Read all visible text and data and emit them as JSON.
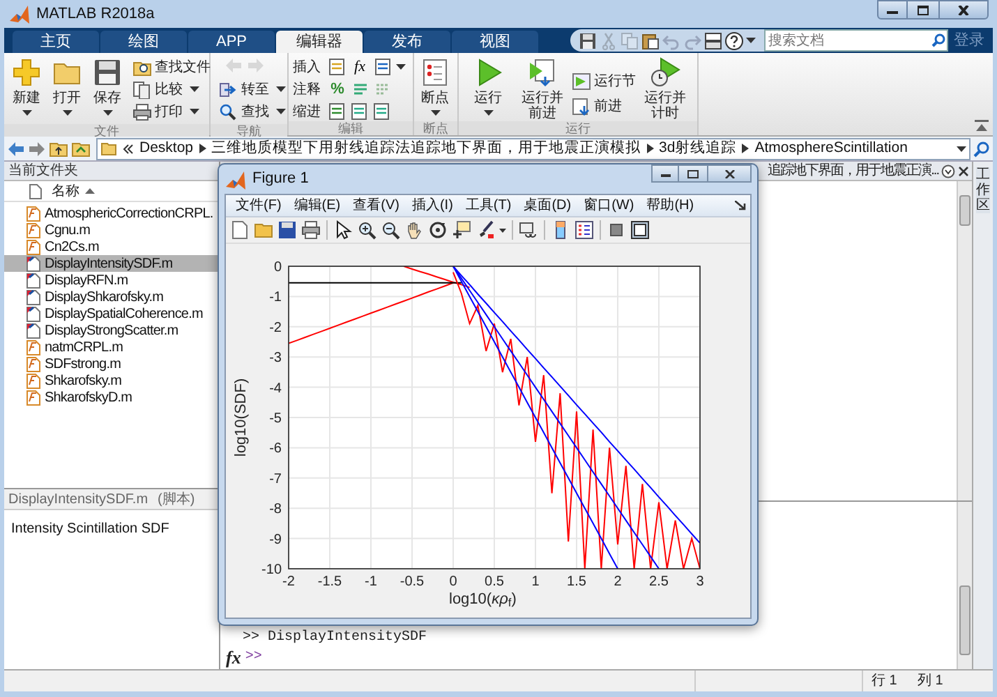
{
  "window": {
    "title": "MATLAB R2018a"
  },
  "tabs": [
    {
      "label": "主页",
      "selected": false
    },
    {
      "label": "绘图",
      "selected": false
    },
    {
      "label": "APP",
      "selected": false
    },
    {
      "label": "编辑器",
      "selected": true
    },
    {
      "label": "发布",
      "selected": false
    },
    {
      "label": "视图",
      "selected": false
    }
  ],
  "quick_access": [
    {
      "disabled": false
    },
    {
      "disabled": true
    },
    {
      "disabled": true
    },
    {
      "disabled": false
    },
    {
      "disabled": true
    },
    {
      "disabled": true
    },
    {
      "disabled": false
    },
    {
      "disabled": false
    }
  ],
  "search": {
    "placeholder": "搜索文档"
  },
  "sign_in": "登录",
  "ribbon": {
    "file": {
      "title": "文件",
      "large": [
        {
          "label": "新建",
          "dropdown": true
        },
        {
          "label": "打开",
          "dropdown": true
        },
        {
          "label": "保存",
          "dropdown": true
        }
      ],
      "small": [
        {
          "label": "查找文件",
          "dropdown": false
        },
        {
          "label": "比较",
          "dropdown": true
        },
        {
          "label": "打印",
          "dropdown": true
        }
      ]
    },
    "navigate": {
      "title": "导航",
      "history": [
        {
          "disabled": true
        },
        {
          "disabled": true
        }
      ],
      "small": [
        {
          "label": "转至",
          "dropdown": true
        },
        {
          "label": "查找",
          "dropdown": true
        }
      ]
    },
    "edit": {
      "title": "编辑",
      "rows": [
        {
          "label": "插入",
          "symbol": "fx"
        },
        {
          "label": "注释",
          "symbol": "%"
        },
        {
          "label": "缩进"
        }
      ]
    },
    "breakpoints": {
      "title": "断点",
      "large": [
        {
          "label": "断点",
          "dropdown": true
        }
      ]
    },
    "run": {
      "title": "运行",
      "items": [
        {
          "kind": "large",
          "label": "运行",
          "dropdown": true
        },
        {
          "kind": "large",
          "label": "运行并前进",
          "dropdown": false
        },
        {
          "kind": "stack",
          "items": [
            {
              "label": "运行节"
            },
            {
              "label": "前进"
            }
          ]
        },
        {
          "kind": "large",
          "label": "运行并计时",
          "dropdown": false
        }
      ]
    }
  },
  "address": {
    "path": [
      "Desktop",
      "三维地质模型下用射线追踪法追踪地下界面，用于地震正演模拟",
      "3d射线追踪",
      "AtmosphereScintillation"
    ]
  },
  "current_folder": {
    "title": "当前文件夹",
    "column": "名称",
    "files": [
      {
        "name": "AtmosphericCorrectionCRPL.",
        "kind": "function",
        "selected": false
      },
      {
        "name": "Cgnu.m",
        "kind": "function",
        "selected": false
      },
      {
        "name": "Cn2Cs.m",
        "kind": "function",
        "selected": false
      },
      {
        "name": "DisplayIntensitySDF.m",
        "kind": "script",
        "selected": true
      },
      {
        "name": "DisplayRFN.m",
        "kind": "script",
        "selected": false
      },
      {
        "name": "DisplayShkarofsky.m",
        "kind": "script",
        "selected": false
      },
      {
        "name": "DisplaySpatialCoherence.m",
        "kind": "script",
        "selected": false
      },
      {
        "name": "DisplayStrongScatter.m",
        "kind": "script",
        "selected": false
      },
      {
        "name": "natmCRPL.m",
        "kind": "function",
        "selected": false
      },
      {
        "name": "SDFstrong.m",
        "kind": "function",
        "selected": false
      },
      {
        "name": "Shkarofsky.m",
        "kind": "function",
        "selected": false
      },
      {
        "name": "ShkarofskyD.m",
        "kind": "function",
        "selected": false
      }
    ],
    "details": {
      "title": "DisplayIntensitySDF.m",
      "type": "(脚本)",
      "description": "Intensity Scintillation SDF"
    }
  },
  "editor": {
    "tab_title": "追踪地下界面，用于地震正演..."
  },
  "workspace": {
    "title": "工作区"
  },
  "command_window": {
    "lines": [
      ">> DisplayIntensitySDF"
    ],
    "fx_label": "fx",
    "prompt": ">>"
  },
  "status_bar": {
    "row": "行 1",
    "column": "列 1"
  },
  "figure": {
    "title": "Figure 1",
    "menu": [
      "文件(F)",
      "编辑(E)",
      "查看(V)",
      "插入(I)",
      "工具(T)",
      "桌面(D)",
      "窗口(W)",
      "帮助(H)"
    ],
    "chart_data": {
      "type": "line",
      "grid": true,
      "xlabel": "log10(*κρ*$_{f}$)",
      "ylabel": "log10(SDF)",
      "xlim": [
        -2,
        3
      ],
      "ylim": [
        -10,
        0
      ],
      "xticks": [
        -2,
        -1.5,
        -1,
        -0.5,
        0,
        0.5,
        1,
        1.5,
        2,
        2.5,
        3
      ],
      "yticks": [
        0,
        -1,
        -2,
        -3,
        -4,
        -5,
        -6,
        -7,
        -8,
        -9,
        -10
      ],
      "x": [
        -2,
        -1.9,
        -1.8,
        -1.7,
        -1.6,
        -1.5,
        -1.4,
        -1.3,
        -1.2,
        -1.1,
        -1,
        -0.9,
        -0.8,
        -0.7,
        -0.6,
        -0.5,
        -0.4,
        -0.3,
        -0.2,
        -0.1,
        0,
        0.1,
        0.2,
        0.3,
        0.4,
        0.5,
        0.6,
        0.7,
        0.8,
        0.9,
        1,
        1.1,
        1.2,
        1.3,
        1.4,
        1.5,
        1.6,
        1.7,
        1.8,
        1.9,
        2,
        2.1,
        2.2,
        2.3,
        2.4,
        2.5,
        2.6,
        2.7,
        2.8,
        2.9,
        3
      ],
      "series": [
        {
          "color": "#ff0000",
          "values": [
            -2.55,
            -2.45,
            -2.35,
            -2.25,
            -2.15,
            -2.05,
            -1.95,
            -1.85,
            -1.75,
            -1.65,
            -1.55,
            -1.45,
            -1.35,
            -1.25,
            -1.15,
            -1.05,
            -0.95,
            -0.85,
            -0.75,
            -0.65,
            -0.55,
            null,
            null,
            null,
            null,
            null,
            null,
            null,
            null,
            null,
            null,
            null,
            null,
            null,
            null,
            null,
            null,
            null,
            null,
            null,
            null,
            null,
            null,
            null,
            null,
            null,
            null,
            null,
            null,
            null,
            null
          ]
        },
        {
          "color": "#ff0000",
          "values": [
            null,
            null,
            null,
            null,
            null,
            null,
            null,
            null,
            null,
            null,
            null,
            null,
            null,
            null,
            0,
            -0.09,
            -0.18,
            -0.26,
            -0.35,
            -0.44,
            -0.53,
            -0.61,
            -0.7,
            null,
            null,
            null,
            null,
            null,
            null,
            null,
            null,
            null,
            null,
            null,
            null,
            null,
            null,
            null,
            null,
            null,
            null,
            null,
            null,
            null,
            null,
            null,
            null,
            null,
            null,
            null,
            null
          ]
        },
        {
          "color": "#000000",
          "values": [
            -0.55,
            -0.55,
            -0.55,
            -0.55,
            -0.55,
            -0.55,
            -0.55,
            -0.55,
            -0.55,
            -0.55,
            -0.55,
            -0.55,
            -0.55,
            -0.55,
            -0.55,
            -0.55,
            -0.55,
            -0.55,
            -0.55,
            -0.55,
            -0.55,
            -0.55,
            null,
            null,
            null,
            null,
            null,
            null,
            null,
            null,
            null,
            null,
            null,
            null,
            null,
            null,
            null,
            null,
            null,
            null,
            null,
            null,
            null,
            null,
            null,
            null,
            null,
            null,
            null,
            null,
            null
          ]
        },
        {
          "color": "#ff0000",
          "values": [
            null,
            null,
            null,
            null,
            null,
            null,
            null,
            null,
            null,
            null,
            null,
            null,
            null,
            null,
            null,
            null,
            null,
            null,
            null,
            null,
            -0.2,
            -0.9,
            -1.9,
            -1.3,
            -2.8,
            -1.9,
            -3.5,
            -2.4,
            -4.6,
            -3,
            -5.8,
            -3.6,
            -7.5,
            -4.2,
            -9.1,
            -4.8,
            -10,
            -5.4,
            -10,
            -6,
            -9.2,
            -6.6,
            -10,
            -7.2,
            -10,
            -7.8,
            -10,
            -8.4,
            -10,
            -9,
            -10
          ]
        },
        {
          "color": "#0000ff",
          "values": [
            null,
            null,
            null,
            null,
            null,
            null,
            null,
            null,
            null,
            null,
            null,
            null,
            null,
            null,
            null,
            null,
            null,
            null,
            null,
            null,
            0,
            -0.31,
            -0.61,
            -0.92,
            -1.22,
            -1.53,
            -1.83,
            -2.14,
            -2.44,
            -2.75,
            -3.05,
            -3.36,
            -3.66,
            -3.97,
            -4.27,
            -4.58,
            -4.88,
            -5.19,
            -5.49,
            -5.8,
            -6.1,
            -6.41,
            -6.71,
            -7.02,
            -7.32,
            -7.63,
            -7.93,
            -8.24,
            -8.54,
            -8.85,
            -9.15
          ]
        },
        {
          "color": "#0000ff",
          "values": [
            null,
            null,
            null,
            null,
            null,
            null,
            null,
            null,
            null,
            null,
            null,
            null,
            null,
            null,
            null,
            null,
            null,
            null,
            null,
            null,
            0,
            -0.4,
            -0.8,
            -1.2,
            -1.6,
            -2,
            -2.4,
            -2.8,
            -3.2,
            -3.6,
            -4,
            -4.4,
            -4.8,
            -5.2,
            -5.6,
            -6,
            -6.4,
            -6.8,
            -7.2,
            -7.6,
            -8,
            -8.4,
            -8.8,
            -9.2,
            -9.6,
            -10,
            null,
            null,
            null,
            null,
            null
          ]
        },
        {
          "color": "#0000ff",
          "values": [
            null,
            null,
            null,
            null,
            null,
            null,
            null,
            null,
            null,
            null,
            null,
            null,
            null,
            null,
            null,
            null,
            null,
            null,
            null,
            null,
            0,
            -0.5,
            -1,
            -1.5,
            -2,
            -2.5,
            -3,
            -3.5,
            -4,
            -4.5,
            -5,
            -5.5,
            -6,
            -6.5,
            -7,
            -7.5,
            -8,
            -8.5,
            -9,
            -9.5,
            -10,
            null,
            null,
            null,
            null,
            null,
            null,
            null,
            null,
            null,
            null
          ]
        }
      ]
    }
  }
}
